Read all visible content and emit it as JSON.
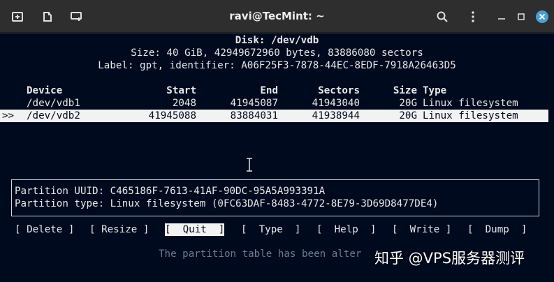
{
  "window": {
    "title": "ravi@TecMint: ~"
  },
  "header": {
    "disk": "Disk: /dev/vdb",
    "size": "Size: 40 GiB, 42949672960 bytes, 83886080 sectors",
    "label": "Label: gpt, identifier: A06F25F3-7878-44EC-8EDF-7918A26463D5"
  },
  "table": {
    "columns": {
      "device": "Device",
      "start": "Start",
      "end": "End",
      "sectors": "Sectors",
      "size": "Size",
      "type": "Type"
    },
    "rows": [
      {
        "marker": "",
        "device": "/dev/vdb1",
        "start": "2048",
        "end": "41945087",
        "sectors": "41943040",
        "size": "20G",
        "type": "Linux filesystem"
      },
      {
        "marker": ">>",
        "device": "/dev/vdb2",
        "start": "41945088",
        "end": "83884031",
        "sectors": "41938944",
        "size": "20G",
        "type": "Linux filesystem"
      }
    ]
  },
  "info": {
    "uuid": "Partition UUID: C465186F-7613-41AF-90DC-95A5A993391A",
    "type": "Partition type: Linux filesystem (0FC63DAF-8483-4772-8E79-3D69D8477DE4)"
  },
  "menu": {
    "delete": "[ Delete ]",
    "resize": "[ Resize ]",
    "quit": "[  Quit  ]",
    "type": "[  Type  ]",
    "help": "[  Help  ]",
    "write": "[  Write ]",
    "dump": "[  Dump  ]"
  },
  "status": "The partition table has been alter",
  "watermark": "知乎 @VPS服务器测评",
  "colors": {
    "terminal_bg": "#000a1f",
    "titlebar_bg": "#2e2e2e",
    "highlight_bg": "#f2f2f2",
    "close_button": "#4a9fd0"
  }
}
